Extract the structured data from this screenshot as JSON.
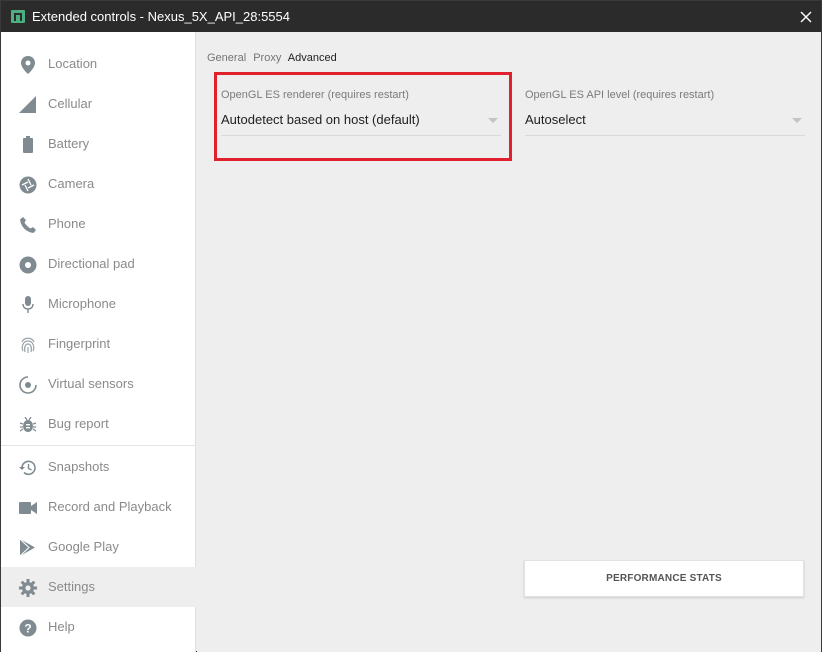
{
  "window": {
    "title": "Extended controls - Nexus_5X_API_28:5554",
    "colors": {
      "titlebar": "#2b2b2b",
      "accent_icon": "#4caf82",
      "highlight": "#e0202c"
    }
  },
  "sidebar": {
    "items": [
      {
        "label": "Location",
        "icon": "location-pin-icon"
      },
      {
        "label": "Cellular",
        "icon": "cellular-signal-icon"
      },
      {
        "label": "Battery",
        "icon": "battery-icon"
      },
      {
        "label": "Camera",
        "icon": "camera-aperture-icon"
      },
      {
        "label": "Phone",
        "icon": "phone-icon"
      },
      {
        "label": "Directional pad",
        "icon": "dpad-icon"
      },
      {
        "label": "Microphone",
        "icon": "microphone-icon"
      },
      {
        "label": "Fingerprint",
        "icon": "fingerprint-icon"
      },
      {
        "label": "Virtual sensors",
        "icon": "rotation-sensor-icon"
      },
      {
        "label": "Bug report",
        "icon": "bug-icon"
      },
      {
        "label": "Snapshots",
        "icon": "history-icon"
      },
      {
        "label": "Record and Playback",
        "icon": "video-camera-icon"
      },
      {
        "label": "Google Play",
        "icon": "play-store-icon"
      },
      {
        "label": "Settings",
        "icon": "gear-icon",
        "selected": true
      },
      {
        "label": "Help",
        "icon": "help-icon"
      }
    ]
  },
  "main": {
    "tabs": [
      {
        "label": "General"
      },
      {
        "label": "Proxy"
      },
      {
        "label": "Advanced",
        "active": true
      }
    ],
    "renderer": {
      "label": "OpenGL ES renderer (requires restart)",
      "value": "Autodetect based on host (default)"
    },
    "api_level": {
      "label": "OpenGL ES API level (requires restart)",
      "value": "Autoselect"
    },
    "perf_button": "PERFORMANCE STATS"
  }
}
